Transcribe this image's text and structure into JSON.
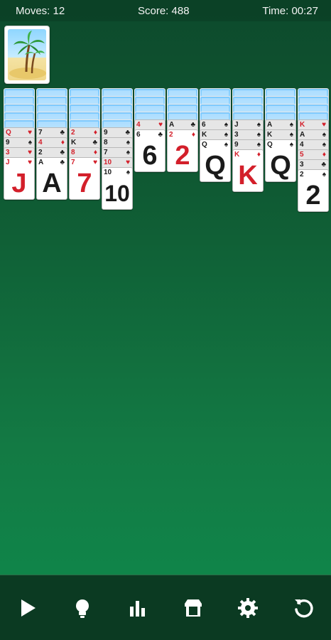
{
  "header": {
    "moves_label": "Moves: 12",
    "score_label": "Score: 488",
    "time_label": "Time: 00:27"
  },
  "columns": [
    {
      "backs": 5,
      "faceup": [
        {
          "r": "Q",
          "s": "♥"
        },
        {
          "r": "9",
          "s": "♠"
        },
        {
          "r": "3",
          "s": "♥"
        },
        {
          "r": "J",
          "s": "♥"
        }
      ]
    },
    {
      "backs": 5,
      "faceup": [
        {
          "r": "7",
          "s": "♣"
        },
        {
          "r": "4",
          "s": "♦"
        },
        {
          "r": "2",
          "s": "♣"
        },
        {
          "r": "A",
          "s": "♣"
        }
      ]
    },
    {
      "backs": 5,
      "faceup": [
        {
          "r": "2",
          "s": "♦"
        },
        {
          "r": "K",
          "s": "♣"
        },
        {
          "r": "8",
          "s": "♦"
        },
        {
          "r": "7",
          "s": "♥"
        }
      ]
    },
    {
      "backs": 5,
      "faceup": [
        {
          "r": "9",
          "s": "♣"
        },
        {
          "r": "8",
          "s": "♠"
        },
        {
          "r": "7",
          "s": "♠"
        },
        {
          "r": "10",
          "s": "♥"
        },
        {
          "r": "10",
          "s": "♠"
        }
      ]
    },
    {
      "backs": 4,
      "faceup": [
        {
          "r": "4",
          "s": "♥"
        },
        {
          "r": "6",
          "s": "♣"
        }
      ]
    },
    {
      "backs": 4,
      "faceup": [
        {
          "r": "A",
          "s": "♣"
        },
        {
          "r": "2",
          "s": "♦"
        }
      ]
    },
    {
      "backs": 4,
      "faceup": [
        {
          "r": "6",
          "s": "♠"
        },
        {
          "r": "K",
          "s": "♠"
        },
        {
          "r": "Q",
          "s": "♠"
        }
      ]
    },
    {
      "backs": 4,
      "faceup": [
        {
          "r": "J",
          "s": "♠"
        },
        {
          "r": "3",
          "s": "♠"
        },
        {
          "r": "9",
          "s": "♠"
        },
        {
          "r": "K",
          "s": "♦"
        }
      ]
    },
    {
      "backs": 4,
      "faceup": [
        {
          "r": "A",
          "s": "♠"
        },
        {
          "r": "K",
          "s": "♠"
        },
        {
          "r": "Q",
          "s": "♠"
        }
      ]
    },
    {
      "backs": 4,
      "faceup": [
        {
          "r": "K",
          "s": "♥"
        },
        {
          "r": "A",
          "s": "♠"
        },
        {
          "r": "4",
          "s": "♠"
        },
        {
          "r": "5",
          "s": "♦"
        },
        {
          "r": "3",
          "s": "♣"
        },
        {
          "r": "2",
          "s": "♠"
        }
      ]
    }
  ],
  "toolbar": [
    {
      "icon": "play-icon",
      "name": "play-button"
    },
    {
      "icon": "hint-icon",
      "name": "hint-button"
    },
    {
      "icon": "stats-icon",
      "name": "stats-button"
    },
    {
      "icon": "store-icon",
      "name": "store-button"
    },
    {
      "icon": "gear-icon",
      "name": "settings-button"
    },
    {
      "icon": "undo-icon",
      "name": "undo-button"
    }
  ],
  "colors": {
    "red": "#d31f2a",
    "black": "#1a1a1a",
    "felt": "#0f6a3a"
  }
}
